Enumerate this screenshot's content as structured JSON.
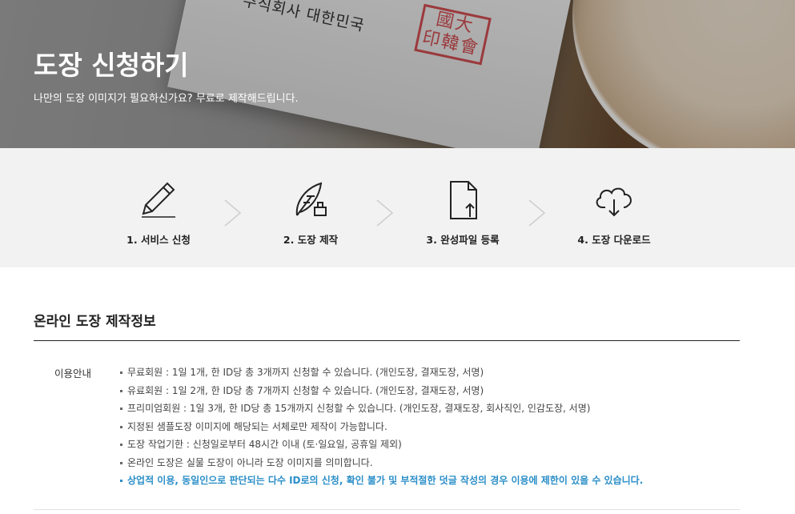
{
  "hero": {
    "title": "도장 신청하기",
    "subtitle": "나만의 도장 이미지가 필요하신가요? 무료로 제작해드립니다.",
    "envelope_text": "주식회사 대한민국",
    "seal_text": "國大 印韓會"
  },
  "steps": [
    {
      "label": "1. 서비스 신청",
      "icon": "pencil-icon"
    },
    {
      "label": "2. 도장 제작",
      "icon": "feather-stamp-icon"
    },
    {
      "label": "3. 완성파일 등록",
      "icon": "file-upload-icon"
    },
    {
      "label": "4. 도장 다운로드",
      "icon": "cloud-download-icon"
    }
  ],
  "info": {
    "title": "온라인 도장 제작정보",
    "label": "이용안내",
    "items": [
      "무료회원 : 1일 1개, 한 ID당 총 3개까지 신청할 수 있습니다. (개인도장, 결재도장, 서명)",
      "유료회원 : 1일 2개, 한 ID당 총 7개까지 신청할 수 있습니다. (개인도장, 결재도장, 서명)",
      "프리미엄회원 : 1일 3개, 한 ID당 총 15개까지 신청할 수 있습니다. (개인도장, 결재도장, 회사직인, 인감도장, 서명)",
      "지정된 샘플도장 이미지에 해당되는 서체로만 제작이 가능합니다.",
      "도장 작업기한 : 신청일로부터 48시간 이내 (토·일요일, 공휴일 제외)",
      "온라인 도장은 실물 도장이 아니라 도장 이미지를 의미합니다.",
      "상업적 이용, 동일인으로 판단되는 다수 ID로의 신청, 확인 불가 및 부적절한 덧글 작성의 경우 이용에 제한이 있을 수 있습니다."
    ]
  },
  "colors": {
    "highlight": "#2a8ec8",
    "steps_bg": "#f2f2f2",
    "seal_red": "#c4262b"
  }
}
